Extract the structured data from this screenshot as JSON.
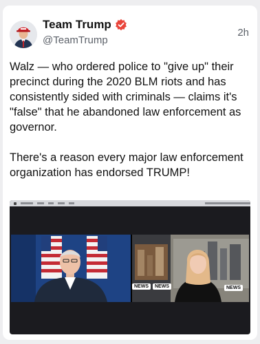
{
  "post": {
    "display_name": "Team Trump",
    "handle": "@TeamTrump",
    "time": "2h",
    "paragraphs": [
      "Walz — who ordered police to \"give up\" their precinct during the 2020 BLM riots and has consistently sided with criminals — claims it's \"false\" that he abandoned law enforcement as governor.",
      "There's a reason every major law enforcement organization has endorsed TRUMP!"
    ]
  },
  "media": {
    "news_bug_1": "NEWS",
    "news_bug_2": "NEWS",
    "news_bug_3": "NEWS"
  },
  "colors": {
    "verified_badge": "#e9443a",
    "secondary_text": "#5b6068",
    "card_background": "#ffffff"
  }
}
